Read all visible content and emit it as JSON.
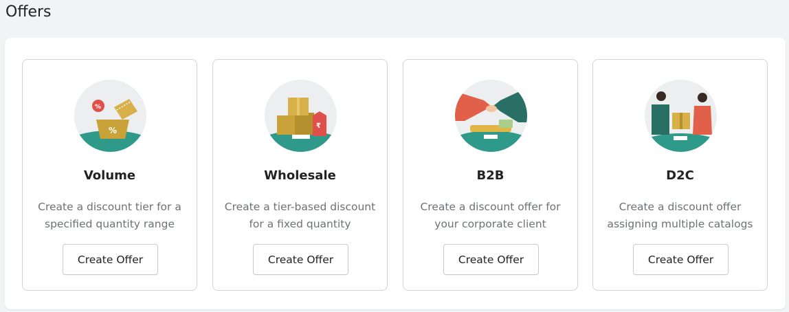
{
  "page": {
    "title": "Offers"
  },
  "cards": [
    {
      "title": "Volume",
      "description_line1": "Create a discount tier for a",
      "description_line2": "specified quantity range",
      "button_label": "Create Offer",
      "icon": "volume-illustration-icon"
    },
    {
      "title": "Wholesale",
      "description_line1": "Create a tier-based discount",
      "description_line2": "for a fixed quantity",
      "button_label": "Create Offer",
      "icon": "wholesale-illustration-icon"
    },
    {
      "title": "B2B",
      "description_line1": "Create a discount offer for",
      "description_line2": "your corporate client",
      "button_label": "Create Offer",
      "icon": "b2b-illustration-icon"
    },
    {
      "title": "D2C",
      "description_line1": "Create a discount offer",
      "description_line2": "assigning multiple catalogs",
      "button_label": "Create Offer",
      "icon": "d2c-illustration-icon"
    }
  ],
  "colors": {
    "teal": "#2f9a8a",
    "gold": "#c9a23a",
    "red": "#e0504a",
    "circle_bg": "#eceeef",
    "page_bg": "#f2f3f5"
  }
}
